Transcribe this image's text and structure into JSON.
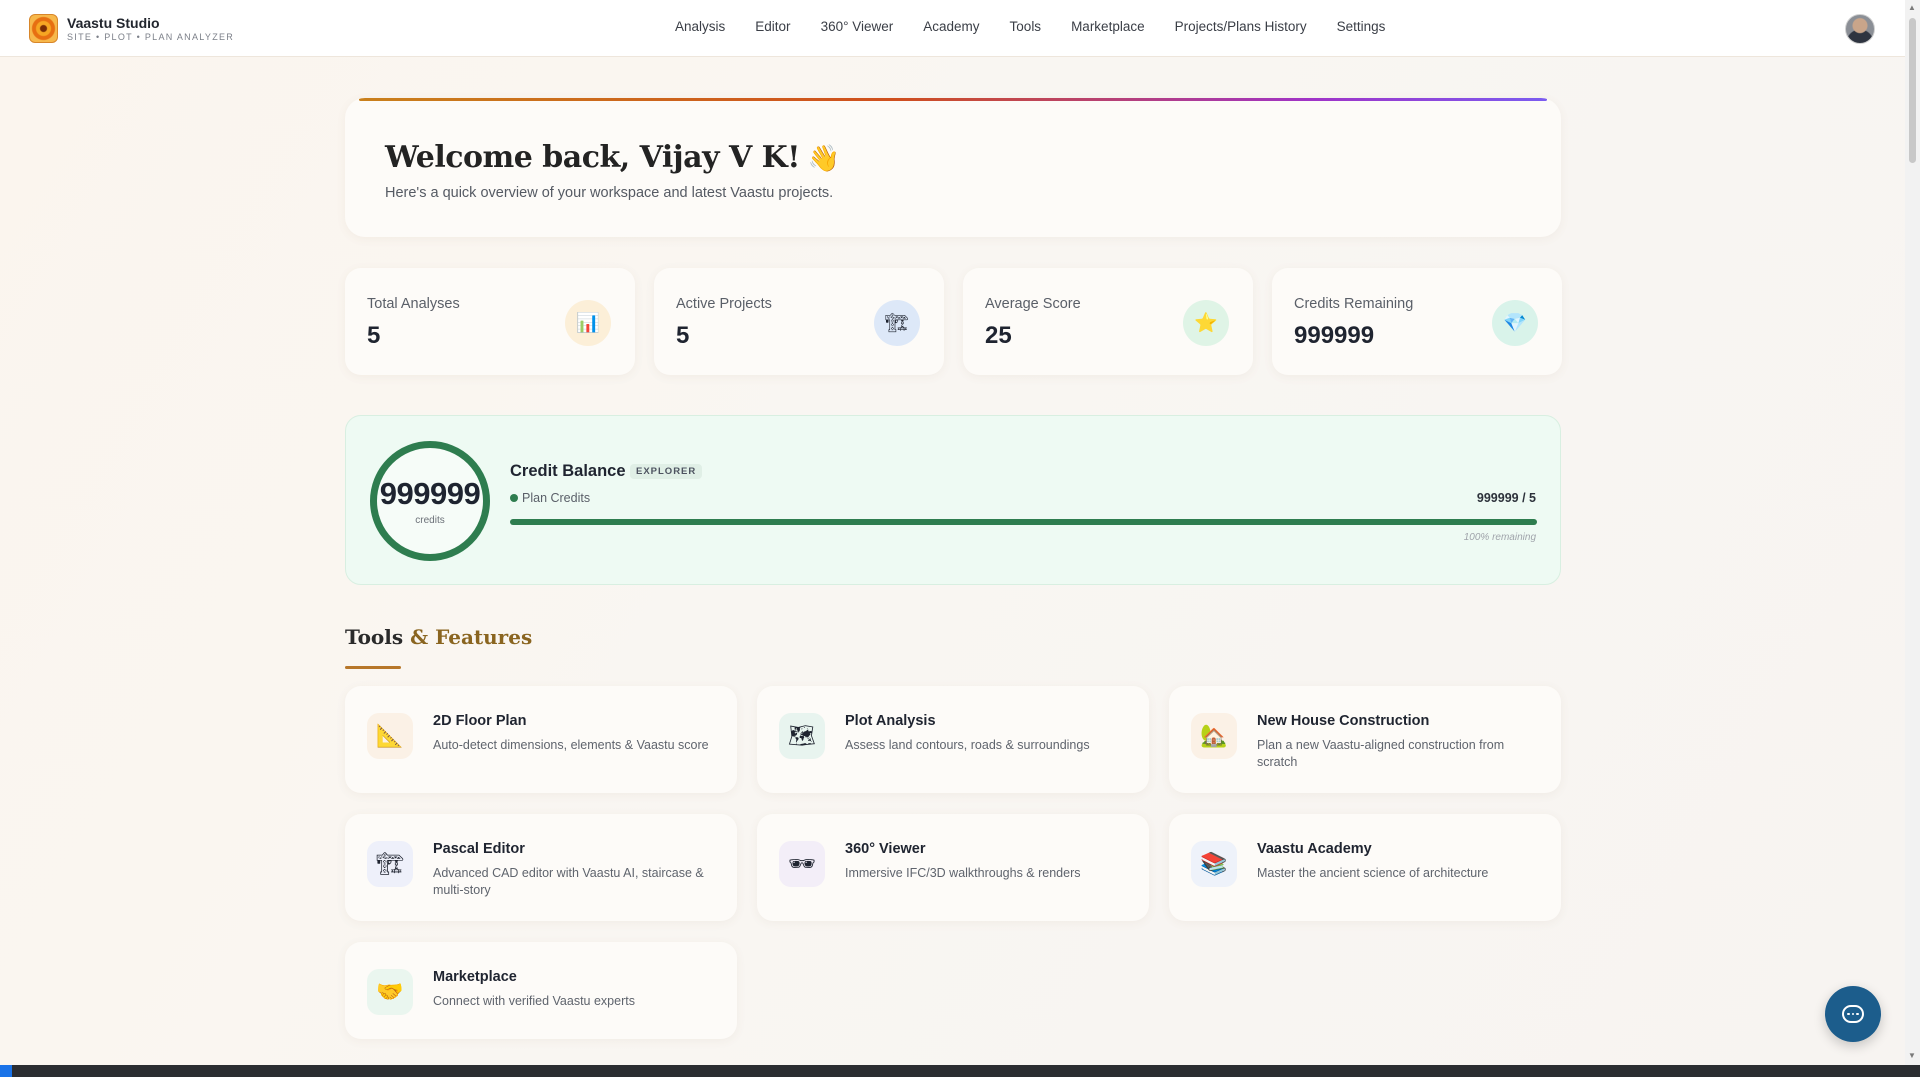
{
  "brand": {
    "title": "Vaastu Studio",
    "subtitle": "SITE • PLOT • PLAN ANALYZER"
  },
  "nav": [
    "Analysis",
    "Editor",
    "360° Viewer",
    "Academy",
    "Tools",
    "Marketplace",
    "Projects/Plans History",
    "Settings"
  ],
  "welcome": {
    "title": "Welcome back, Vijay V K!",
    "wave": "👋",
    "subtitle": "Here's a quick overview of your workspace and latest Vaastu projects."
  },
  "stats": [
    {
      "label": "Total Analyses",
      "value": "5",
      "icon": "bar-chart-icon",
      "glyph": "📊",
      "color": "#fcefd8"
    },
    {
      "label": "Active Projects",
      "value": "5",
      "icon": "construction-icon",
      "glyph": "🏗",
      "color": "#dde8f8"
    },
    {
      "label": "Average Score",
      "value": "25",
      "icon": "star-icon",
      "glyph": "⭐",
      "color": "#dff4e6"
    },
    {
      "label": "Credits Remaining",
      "value": "999999",
      "icon": "gem-icon",
      "glyph": "💎",
      "color": "#d9f3ea"
    }
  ],
  "credit": {
    "ring_value": "999999",
    "ring_label": "credits",
    "title": "Credit Balance",
    "tier": "EXPLORER",
    "plan_label": "Plan Credits",
    "plan_count": "999999 / 5",
    "progress_fraction": 1.0,
    "remaining": "100% remaining"
  },
  "section": {
    "title_a": "Tools ",
    "title_amp": "& Features"
  },
  "tools": [
    {
      "name": "2D Floor Plan",
      "desc": "Auto-detect dimensions, elements & Vaastu score",
      "icon": "ruler-triangle-icon",
      "glyph": "📐"
    },
    {
      "name": "Plot Analysis",
      "desc": "Assess land contours, roads & surroundings",
      "icon": "map-icon",
      "glyph": "🗺"
    },
    {
      "name": "New House Construction",
      "desc": "Plan a new Vaastu-aligned construction from scratch",
      "icon": "house-icon",
      "glyph": "🏡"
    },
    {
      "name": "Pascal Editor",
      "desc": "Advanced CAD editor with Vaastu AI, staircase & multi-story",
      "icon": "construction-icon",
      "glyph": "🏗"
    },
    {
      "name": "360° Viewer",
      "desc": "Immersive IFC/3D walkthroughs & renders",
      "icon": "vr-glasses-icon",
      "glyph": "🕶"
    },
    {
      "name": "Vaastu Academy",
      "desc": "Master the ancient science of architecture",
      "icon": "books-icon",
      "glyph": "📚"
    },
    {
      "name": "Marketplace",
      "desc": "Connect with verified Vaastu experts",
      "icon": "handshake-icon",
      "glyph": "🤝"
    }
  ]
}
